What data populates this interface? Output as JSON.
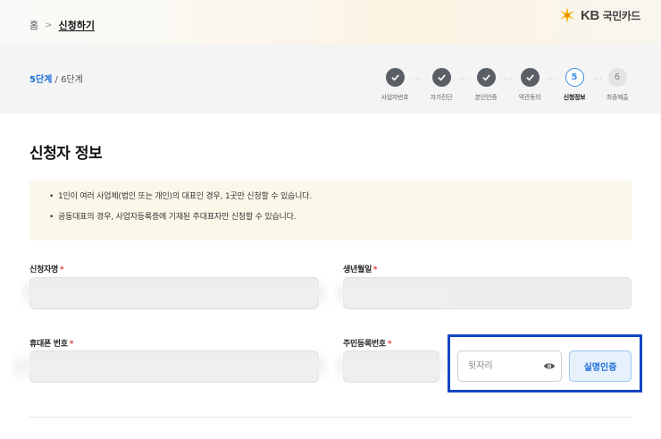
{
  "breadcrumb": {
    "home": "홈",
    "separator": ">",
    "current": "신청하기"
  },
  "logo": {
    "kb": "KB",
    "name": "국민카드"
  },
  "progress": {
    "current": "5단계",
    "total": " / 6단계"
  },
  "steps": [
    {
      "label": "사업자번호",
      "state": "done"
    },
    {
      "label": "자가진단",
      "state": "done"
    },
    {
      "label": "본인인증",
      "state": "done"
    },
    {
      "label": "약관동의",
      "state": "done"
    },
    {
      "label": "신청정보",
      "state": "active",
      "number": "5"
    },
    {
      "label": "최종제출",
      "state": "pending",
      "number": "6"
    }
  ],
  "section_title": "신청자 정보",
  "notices": [
    "1인이 여러 사업체(법인 또는 개인)의 대표인 경우, 1곳만 신청할 수 있습니다.",
    "공동대표의 경우, 사업자등록증에 기재된 주대표자만 신청할 수 있습니다."
  ],
  "fields": {
    "name_label": "신청자명",
    "birth_label": "생년월일",
    "phone_label": "휴대폰 번호",
    "rrn_label": "주민등록번호",
    "required_mark": "*",
    "rrn_back_placeholder": "뒷자리"
  },
  "buttons": {
    "verify": "실명인증"
  },
  "colors": {
    "accent": "#1a6fd8",
    "highlight_border": "#1346c4",
    "required": "#e23b3b",
    "notice_bg": "#fbf8e9"
  }
}
